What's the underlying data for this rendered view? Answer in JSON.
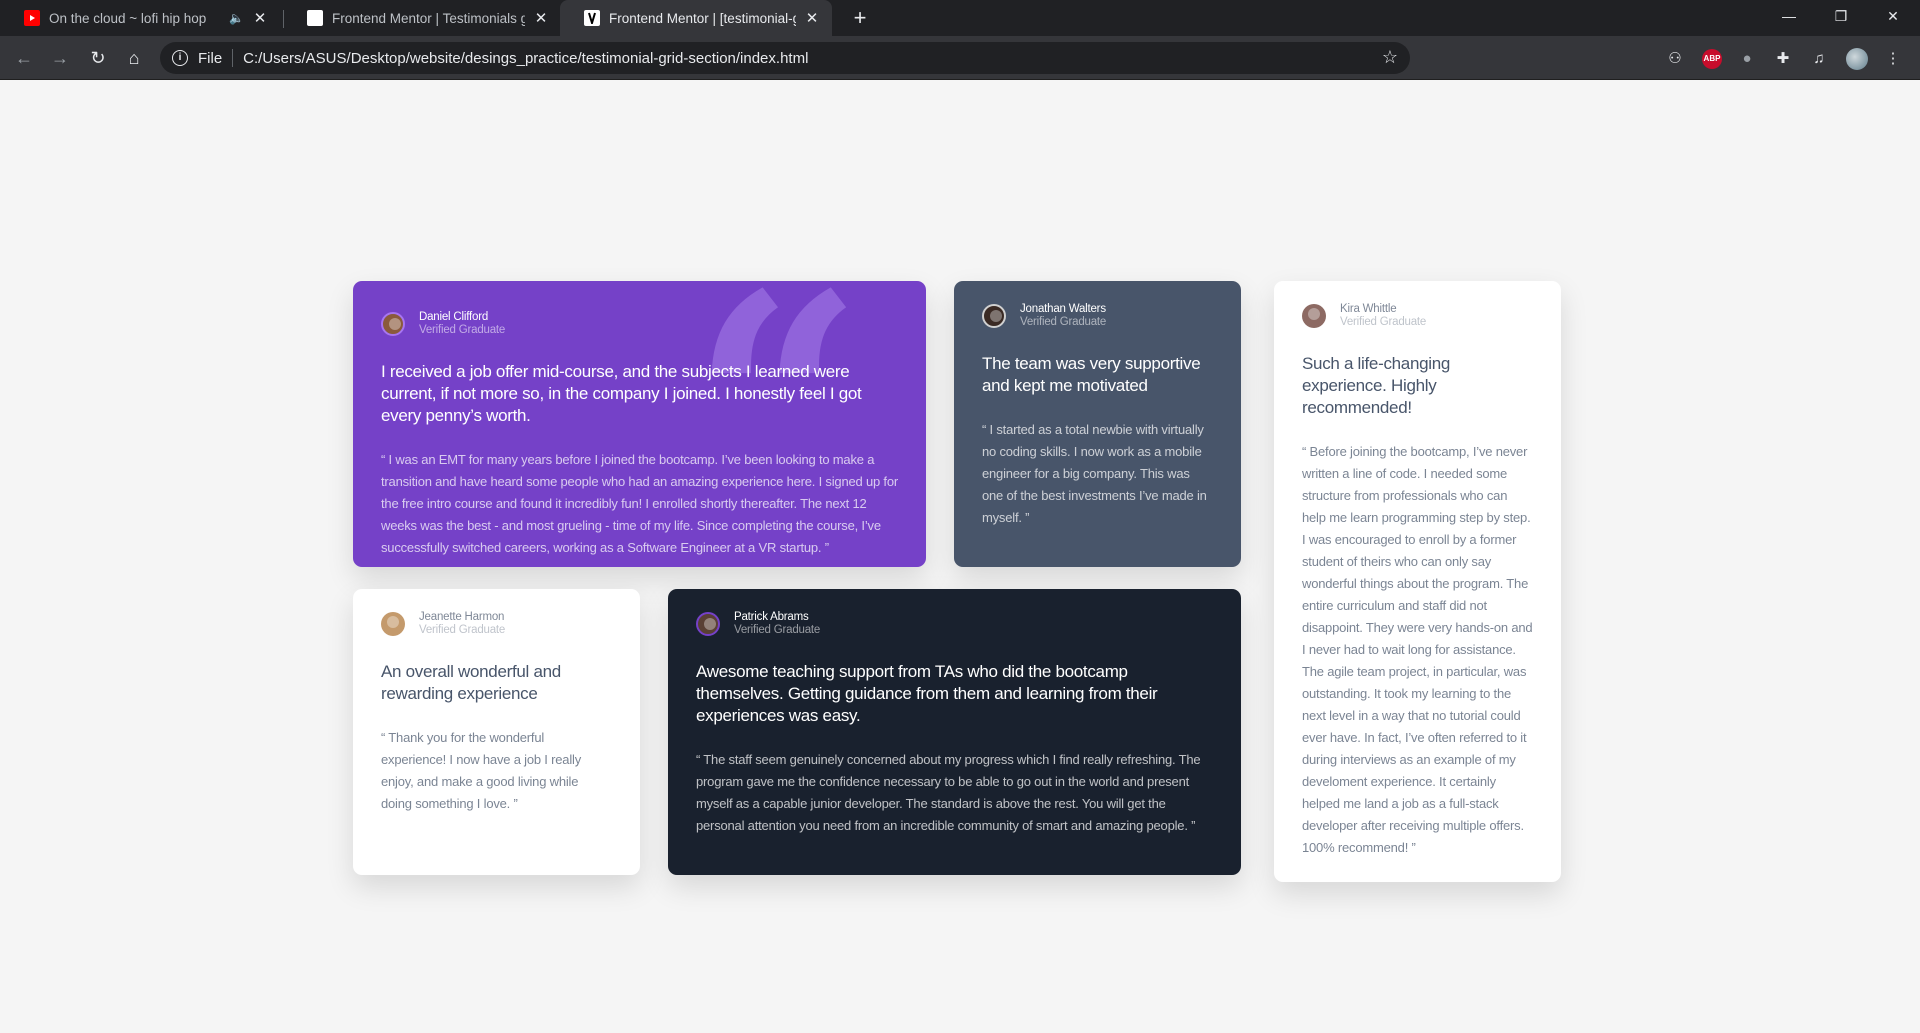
{
  "browser": {
    "tabs": [
      {
        "title": "On the cloud ~ lofi hip hop",
        "icon": "youtube-icon"
      },
      {
        "title": "Frontend Mentor | Testimonials g",
        "icon": "frontend-mentor-icon"
      },
      {
        "title": "Frontend Mentor | [testimonial-g",
        "icon": "frontend-mentor-icon"
      }
    ],
    "new_tab": "+",
    "window_controls": {
      "minimize": "—",
      "restore": "❐",
      "close": "✕"
    },
    "address": {
      "scheme_label": "File",
      "url": "C:/Users/ASUS/Desktop/website/desings_practice/testimonial-grid-section/index.html"
    },
    "abp_label": "ABP"
  },
  "testimonials": [
    {
      "name": "Daniel Clifford",
      "role": "Verified Graduate",
      "headline": "I received a job offer mid-course, and the subjects I learned were current, if not more so, in the company I joined. I honestly feel I got every penny’s worth.",
      "quote": "“ I was an EMT for many years before I joined the bootcamp. I’ve been looking to make a transition and have heard some people who had an amazing experience here. I signed up for the free intro course and found it incredibly fun! I enrolled shortly thereafter. The next 12 weeks was the best - and most grueling - time of my life. Since completing the course, I’ve successfully switched careers, working as a Software Engineer at a VR startup. ”",
      "bg": "#7541c8"
    },
    {
      "name": "Jonathan Walters",
      "role": "Verified Graduate",
      "headline": "The team was very supportive and kept me motivated",
      "quote": "“ I started as a total newbie with virtually no coding skills. I now work as a mobile engineer for a big company. This was one of the best investments I’ve made in myself. ”",
      "bg": "#48556a"
    },
    {
      "name": "Kira Whittle",
      "role": "Verified Graduate",
      "headline": "Such a life-changing experience. Highly recommended!",
      "quote": "“ Before joining the bootcamp, I’ve never written a line of code. I needed some structure from professionals who can help me learn programming step by step. I was encouraged to enroll by a former student of theirs who can only say wonderful things about the program. The entire curriculum and staff did not disappoint. They were very hands-on and I never had to wait long for assistance. The agile team project, in particular, was outstanding. It took my learning to the next level in a way that no tutorial could ever have. In fact, I’ve often referred to it during interviews as an example of my develoment experience. It certainly helped me land a job as a full-stack developer after receiving multiple offers. 100% recommend! ”",
      "bg": "#ffffff"
    },
    {
      "name": "Jeanette Harmon",
      "role": "Verified Graduate",
      "headline": "An overall wonderful and rewarding experience",
      "quote": "“ Thank you for the wonderful experience! I now have a job I really enjoy, and make a good living while doing something I love. ”",
      "bg": "#ffffff"
    },
    {
      "name": "Patrick Abrams",
      "role": "Verified Graduate",
      "headline": "Awesome teaching support from TAs who did the bootcamp themselves. Getting guidance from them and learning from their experiences was easy.",
      "quote": "“ The staff seem genuinely concerned about my progress which I find really refreshing. The program gave me the confidence necessary to be able to go out in the world and present myself as a capable junior developer. The standard is above the rest. You will get the personal attention you need from an incredible community of smart and amazing people. ”",
      "bg": "#19212e"
    }
  ]
}
